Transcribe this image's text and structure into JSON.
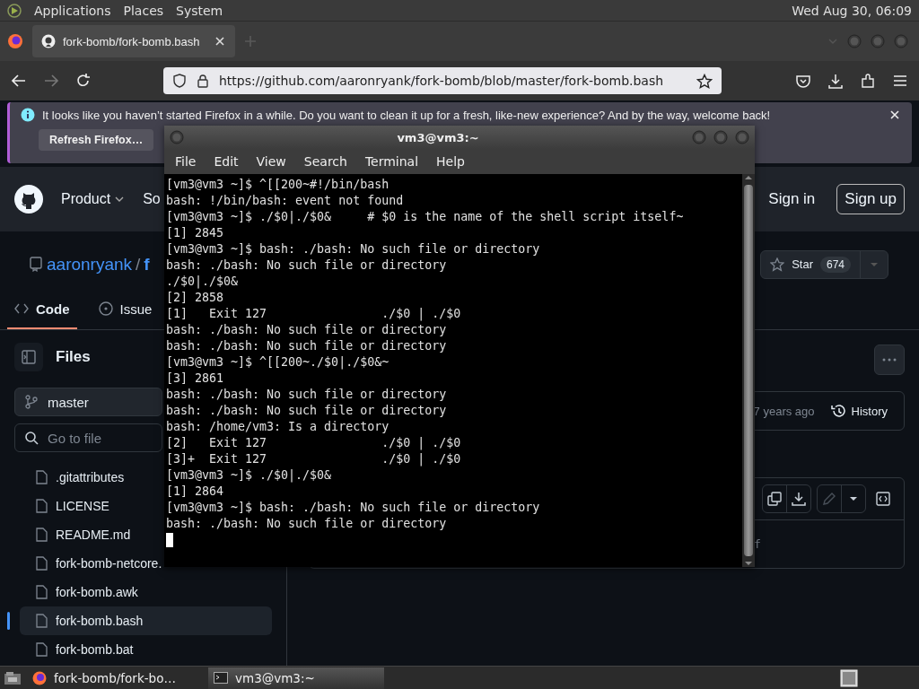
{
  "top_panel": {
    "menus": [
      "Applications",
      "Places",
      "System"
    ],
    "clock": "Wed Aug 30, 06:09"
  },
  "browser": {
    "tabs": [
      {
        "title": "fork-bomb/fork-bomb.bash",
        "selected": true
      }
    ],
    "url": "https://github.com/aaronryank/fork-bomb/blob/master/fork-bomb.bash",
    "notification": {
      "message": "It looks like you haven’t started Firefox in a while. Do you want to clean it up for a fresh, like-new experience? And by the way, welcome back!",
      "button": "Refresh Firefox…"
    }
  },
  "github": {
    "nav": [
      "Product",
      "So"
    ],
    "sign_in": "Sign in",
    "sign_up": "Sign up",
    "owner": "aaronryank",
    "separator": "/",
    "repo": "f",
    "star": {
      "label": "Star",
      "count": "674"
    },
    "tabs": [
      {
        "label": "Code",
        "selected": true
      },
      {
        "label": "Issue",
        "selected": false
      }
    ],
    "files_title": "Files",
    "branch": "master",
    "file_search": {
      "placeholder": "Go to file"
    },
    "files": [
      {
        "name": ".gitattributes",
        "selected": false
      },
      {
        "name": "LICENSE",
        "selected": false
      },
      {
        "name": "README.md",
        "selected": false
      },
      {
        "name": "fork-bomb-netcore.",
        "selected": false
      },
      {
        "name": "fork-bomb.awk",
        "selected": false
      },
      {
        "name": "fork-bomb.bash",
        "selected": true
      },
      {
        "name": "fork-bomb.bat",
        "selected": false
      }
    ],
    "commit_time": "7 years ago",
    "history": "History",
    "code_peek": "f"
  },
  "terminal": {
    "title": "vm3@vm3:~",
    "menus": [
      "File",
      "Edit",
      "View",
      "Search",
      "Terminal",
      "Help"
    ],
    "lines": [
      "[vm3@vm3 ~]$ ^[[200~#!/bin/bash",
      "bash: !/bin/bash: event not found",
      "[vm3@vm3 ~]$ ./$0|./$0&     # $0 is the name of the shell script itself~",
      "[1] 2845",
      "[vm3@vm3 ~]$ bash: ./bash: No such file or directory",
      "bash: ./bash: No such file or directory",
      "./$0|./$0&",
      "[2] 2858",
      "[1]   Exit 127                ./$0 | ./$0",
      "bash: ./bash: No such file or directory",
      "bash: ./bash: No such file or directory",
      "[vm3@vm3 ~]$ ^[[200~./$0|./$0&~",
      "[3] 2861",
      "bash: ./bash: No such file or directory",
      "bash: ./bash: No such file or directory",
      "bash: /home/vm3: Is a directory",
      "[2]   Exit 127                ./$0 | ./$0",
      "[3]+  Exit 127                ./$0 | ./$0",
      "[vm3@vm3 ~]$ ./$0|./$0&",
      "[1] 2864",
      "[vm3@vm3 ~]$ bash: ./bash: No such file or directory",
      "bash: ./bash: No such file or directory"
    ]
  },
  "taskbar": {
    "tasks": [
      {
        "label": "fork-bomb/fork-bo…",
        "kind": "browser",
        "selected": false
      },
      {
        "label": "vm3@vm3:~",
        "kind": "terminal",
        "selected": true
      }
    ]
  }
}
